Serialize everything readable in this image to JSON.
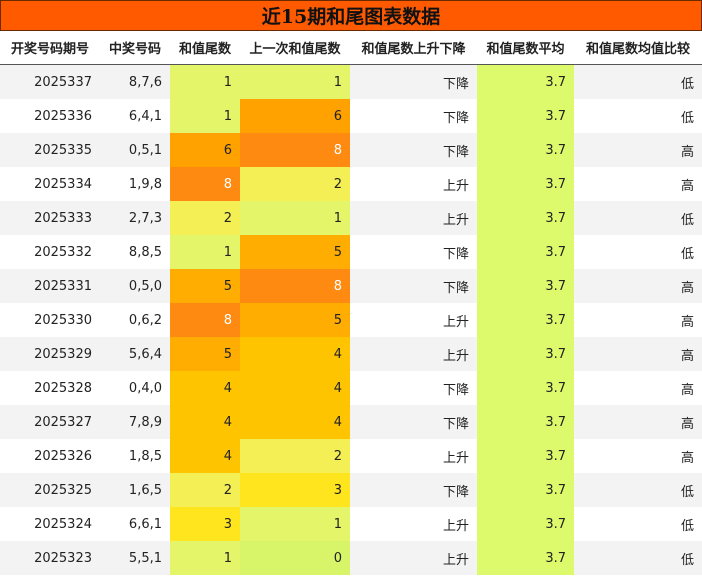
{
  "title": "近15期和尾图表数据",
  "headers": [
    "开奖号码期号",
    "中奖号码",
    "和值尾数",
    "上一次和值尾数",
    "和值尾数上升下降",
    "和值尾数平均",
    "和值尾数均值比较"
  ],
  "rows": [
    {
      "issue": "2025337",
      "numbers": "8,7,6",
      "tail": "1",
      "prev_tail": "1",
      "trend": "下降",
      "avg": "3.7",
      "compare": "低"
    },
    {
      "issue": "2025336",
      "numbers": "6,4,1",
      "tail": "1",
      "prev_tail": "6",
      "trend": "下降",
      "avg": "3.7",
      "compare": "低"
    },
    {
      "issue": "2025335",
      "numbers": "0,5,1",
      "tail": "6",
      "prev_tail": "8",
      "trend": "下降",
      "avg": "3.7",
      "compare": "高"
    },
    {
      "issue": "2025334",
      "numbers": "1,9,8",
      "tail": "8",
      "prev_tail": "2",
      "trend": "上升",
      "avg": "3.7",
      "compare": "高"
    },
    {
      "issue": "2025333",
      "numbers": "2,7,3",
      "tail": "2",
      "prev_tail": "1",
      "trend": "上升",
      "avg": "3.7",
      "compare": "低"
    },
    {
      "issue": "2025332",
      "numbers": "8,8,5",
      "tail": "1",
      "prev_tail": "5",
      "trend": "下降",
      "avg": "3.7",
      "compare": "低"
    },
    {
      "issue": "2025331",
      "numbers": "0,5,0",
      "tail": "5",
      "prev_tail": "8",
      "trend": "下降",
      "avg": "3.7",
      "compare": "高"
    },
    {
      "issue": "2025330",
      "numbers": "0,6,2",
      "tail": "8",
      "prev_tail": "5",
      "trend": "上升",
      "avg": "3.7",
      "compare": "高"
    },
    {
      "issue": "2025329",
      "numbers": "5,6,4",
      "tail": "5",
      "prev_tail": "4",
      "trend": "上升",
      "avg": "3.7",
      "compare": "高"
    },
    {
      "issue": "2025328",
      "numbers": "0,4,0",
      "tail": "4",
      "prev_tail": "4",
      "trend": "下降",
      "avg": "3.7",
      "compare": "高"
    },
    {
      "issue": "2025327",
      "numbers": "7,8,9",
      "tail": "4",
      "prev_tail": "4",
      "trend": "下降",
      "avg": "3.7",
      "compare": "高"
    },
    {
      "issue": "2025326",
      "numbers": "1,8,5",
      "tail": "4",
      "prev_tail": "2",
      "trend": "上升",
      "avg": "3.7",
      "compare": "高"
    },
    {
      "issue": "2025325",
      "numbers": "1,6,5",
      "tail": "2",
      "prev_tail": "3",
      "trend": "下降",
      "avg": "3.7",
      "compare": "低"
    },
    {
      "issue": "2025324",
      "numbers": "6,6,1",
      "tail": "3",
      "prev_tail": "1",
      "trend": "上升",
      "avg": "3.7",
      "compare": "低"
    },
    {
      "issue": "2025323",
      "numbers": "5,5,1",
      "tail": "1",
      "prev_tail": "0",
      "trend": "上升",
      "avg": "3.7",
      "compare": "低"
    }
  ],
  "colors": {
    "title_bg": "#ff5a00",
    "avg_bg": "#dcfa6c",
    "scale": {
      "0": "#d8f56a",
      "1": "#e4f56a",
      "2": "#f4ef55",
      "3": "#ffe51e",
      "4": "#ffc400",
      "5": "#ffad00",
      "6": "#ffa200",
      "8": "#ff8a12"
    }
  }
}
